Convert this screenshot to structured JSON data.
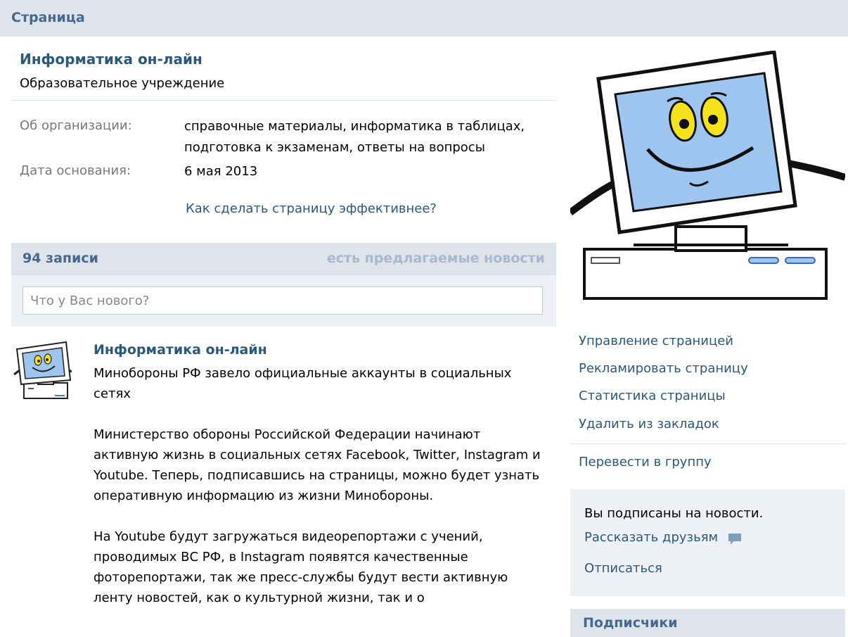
{
  "topbar": {
    "title": "Страница"
  },
  "page": {
    "name": "Информатика он-лайн",
    "type": "Образовательное учреждение",
    "info": [
      {
        "label": "Об организации:",
        "value": "справочные материалы, информатика в таблицах, подготовка к экзаменам, ответы на вопросы"
      },
      {
        "label": "Дата основания:",
        "value": "6 мая 2013"
      }
    ],
    "effect_link": "Как сделать страницу эффективнее?"
  },
  "wall": {
    "count_label": "94 записи",
    "suggested_label": "есть предлагаемые новости",
    "composer_placeholder": "Что у Вас нового?"
  },
  "post": {
    "author": "Информатика он-лайн",
    "paragraphs": [
      "Минобороны РФ завело официальные аккаунты в социальных сетях",
      "Министерство обороны Российской Федерации начинают активную жизнь в социальных сетях Facebook, Twitter, Instagram и Youtube. Теперь, подписавшись на страницы, можно будет узнать оперативную информацию из жизни Минобороны.",
      "На Youtube будут загружаться видеорепортажи с учений, проводимых ВС РФ, в Instagram появятся качественные фоторепортажи, так же пресс-службы будут вести активную ленту новостей, как о культурной жизни, так и о"
    ]
  },
  "sidebar": {
    "menu": [
      "Управление страницей",
      "Рекламировать страницу",
      "Статистика страницы",
      "Удалить из закладок",
      "Перевести в группу"
    ],
    "subscribe": {
      "status": "Вы подписаны на новости.",
      "tell_friends": "Рассказать друзьям",
      "unsubscribe": "Отписаться"
    },
    "followers_label": "Подписчики"
  },
  "icons": {
    "share": "speech-bubble-icon",
    "avatar": "computer-mascot-icon"
  },
  "colors": {
    "link": "#2b587a",
    "header_bg": "#dfe4ea",
    "box_bg": "#edf0f4",
    "muted": "#a8b9cb"
  }
}
